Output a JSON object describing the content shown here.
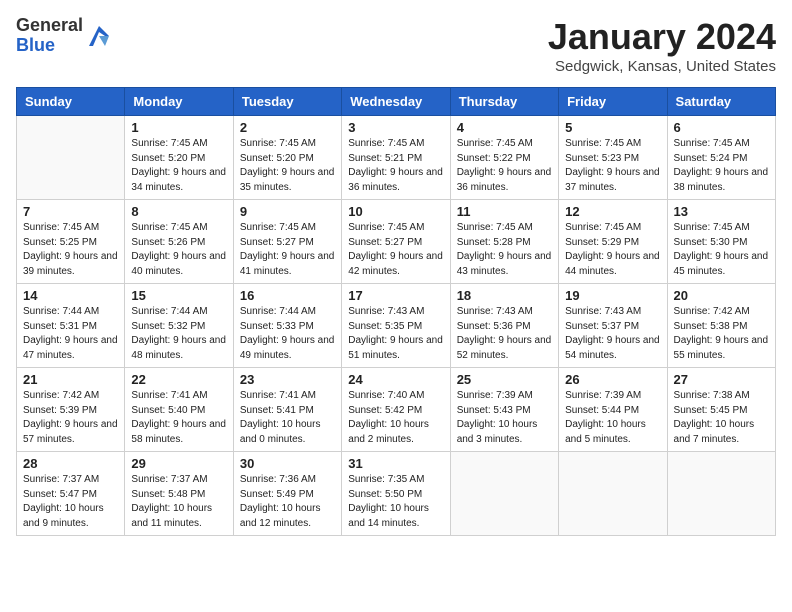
{
  "header": {
    "logo_general": "General",
    "logo_blue": "Blue",
    "month_title": "January 2024",
    "location": "Sedgwick, Kansas, United States"
  },
  "days_of_week": [
    "Sunday",
    "Monday",
    "Tuesday",
    "Wednesday",
    "Thursday",
    "Friday",
    "Saturday"
  ],
  "weeks": [
    [
      {
        "day": "",
        "sunrise": "",
        "sunset": "",
        "daylight": ""
      },
      {
        "day": "1",
        "sunrise": "Sunrise: 7:45 AM",
        "sunset": "Sunset: 5:20 PM",
        "daylight": "Daylight: 9 hours and 34 minutes."
      },
      {
        "day": "2",
        "sunrise": "Sunrise: 7:45 AM",
        "sunset": "Sunset: 5:20 PM",
        "daylight": "Daylight: 9 hours and 35 minutes."
      },
      {
        "day": "3",
        "sunrise": "Sunrise: 7:45 AM",
        "sunset": "Sunset: 5:21 PM",
        "daylight": "Daylight: 9 hours and 36 minutes."
      },
      {
        "day": "4",
        "sunrise": "Sunrise: 7:45 AM",
        "sunset": "Sunset: 5:22 PM",
        "daylight": "Daylight: 9 hours and 36 minutes."
      },
      {
        "day": "5",
        "sunrise": "Sunrise: 7:45 AM",
        "sunset": "Sunset: 5:23 PM",
        "daylight": "Daylight: 9 hours and 37 minutes."
      },
      {
        "day": "6",
        "sunrise": "Sunrise: 7:45 AM",
        "sunset": "Sunset: 5:24 PM",
        "daylight": "Daylight: 9 hours and 38 minutes."
      }
    ],
    [
      {
        "day": "7",
        "sunrise": "Sunrise: 7:45 AM",
        "sunset": "Sunset: 5:25 PM",
        "daylight": "Daylight: 9 hours and 39 minutes."
      },
      {
        "day": "8",
        "sunrise": "Sunrise: 7:45 AM",
        "sunset": "Sunset: 5:26 PM",
        "daylight": "Daylight: 9 hours and 40 minutes."
      },
      {
        "day": "9",
        "sunrise": "Sunrise: 7:45 AM",
        "sunset": "Sunset: 5:27 PM",
        "daylight": "Daylight: 9 hours and 41 minutes."
      },
      {
        "day": "10",
        "sunrise": "Sunrise: 7:45 AM",
        "sunset": "Sunset: 5:27 PM",
        "daylight": "Daylight: 9 hours and 42 minutes."
      },
      {
        "day": "11",
        "sunrise": "Sunrise: 7:45 AM",
        "sunset": "Sunset: 5:28 PM",
        "daylight": "Daylight: 9 hours and 43 minutes."
      },
      {
        "day": "12",
        "sunrise": "Sunrise: 7:45 AM",
        "sunset": "Sunset: 5:29 PM",
        "daylight": "Daylight: 9 hours and 44 minutes."
      },
      {
        "day": "13",
        "sunrise": "Sunrise: 7:45 AM",
        "sunset": "Sunset: 5:30 PM",
        "daylight": "Daylight: 9 hours and 45 minutes."
      }
    ],
    [
      {
        "day": "14",
        "sunrise": "Sunrise: 7:44 AM",
        "sunset": "Sunset: 5:31 PM",
        "daylight": "Daylight: 9 hours and 47 minutes."
      },
      {
        "day": "15",
        "sunrise": "Sunrise: 7:44 AM",
        "sunset": "Sunset: 5:32 PM",
        "daylight": "Daylight: 9 hours and 48 minutes."
      },
      {
        "day": "16",
        "sunrise": "Sunrise: 7:44 AM",
        "sunset": "Sunset: 5:33 PM",
        "daylight": "Daylight: 9 hours and 49 minutes."
      },
      {
        "day": "17",
        "sunrise": "Sunrise: 7:43 AM",
        "sunset": "Sunset: 5:35 PM",
        "daylight": "Daylight: 9 hours and 51 minutes."
      },
      {
        "day": "18",
        "sunrise": "Sunrise: 7:43 AM",
        "sunset": "Sunset: 5:36 PM",
        "daylight": "Daylight: 9 hours and 52 minutes."
      },
      {
        "day": "19",
        "sunrise": "Sunrise: 7:43 AM",
        "sunset": "Sunset: 5:37 PM",
        "daylight": "Daylight: 9 hours and 54 minutes."
      },
      {
        "day": "20",
        "sunrise": "Sunrise: 7:42 AM",
        "sunset": "Sunset: 5:38 PM",
        "daylight": "Daylight: 9 hours and 55 minutes."
      }
    ],
    [
      {
        "day": "21",
        "sunrise": "Sunrise: 7:42 AM",
        "sunset": "Sunset: 5:39 PM",
        "daylight": "Daylight: 9 hours and 57 minutes."
      },
      {
        "day": "22",
        "sunrise": "Sunrise: 7:41 AM",
        "sunset": "Sunset: 5:40 PM",
        "daylight": "Daylight: 9 hours and 58 minutes."
      },
      {
        "day": "23",
        "sunrise": "Sunrise: 7:41 AM",
        "sunset": "Sunset: 5:41 PM",
        "daylight": "Daylight: 10 hours and 0 minutes."
      },
      {
        "day": "24",
        "sunrise": "Sunrise: 7:40 AM",
        "sunset": "Sunset: 5:42 PM",
        "daylight": "Daylight: 10 hours and 2 minutes."
      },
      {
        "day": "25",
        "sunrise": "Sunrise: 7:39 AM",
        "sunset": "Sunset: 5:43 PM",
        "daylight": "Daylight: 10 hours and 3 minutes."
      },
      {
        "day": "26",
        "sunrise": "Sunrise: 7:39 AM",
        "sunset": "Sunset: 5:44 PM",
        "daylight": "Daylight: 10 hours and 5 minutes."
      },
      {
        "day": "27",
        "sunrise": "Sunrise: 7:38 AM",
        "sunset": "Sunset: 5:45 PM",
        "daylight": "Daylight: 10 hours and 7 minutes."
      }
    ],
    [
      {
        "day": "28",
        "sunrise": "Sunrise: 7:37 AM",
        "sunset": "Sunset: 5:47 PM",
        "daylight": "Daylight: 10 hours and 9 minutes."
      },
      {
        "day": "29",
        "sunrise": "Sunrise: 7:37 AM",
        "sunset": "Sunset: 5:48 PM",
        "daylight": "Daylight: 10 hours and 11 minutes."
      },
      {
        "day": "30",
        "sunrise": "Sunrise: 7:36 AM",
        "sunset": "Sunset: 5:49 PM",
        "daylight": "Daylight: 10 hours and 12 minutes."
      },
      {
        "day": "31",
        "sunrise": "Sunrise: 7:35 AM",
        "sunset": "Sunset: 5:50 PM",
        "daylight": "Daylight: 10 hours and 14 minutes."
      },
      {
        "day": "",
        "sunrise": "",
        "sunset": "",
        "daylight": ""
      },
      {
        "day": "",
        "sunrise": "",
        "sunset": "",
        "daylight": ""
      },
      {
        "day": "",
        "sunrise": "",
        "sunset": "",
        "daylight": ""
      }
    ]
  ]
}
